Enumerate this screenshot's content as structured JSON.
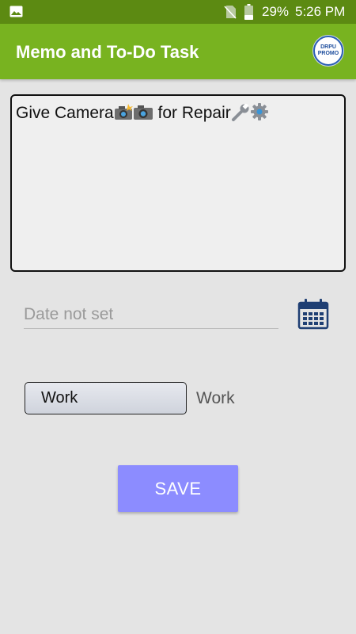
{
  "status_bar": {
    "icons": [
      "gallery-icon",
      "no-sim-icon",
      "battery-icon"
    ],
    "battery": "29%",
    "time": "5:26 PM"
  },
  "app_bar": {
    "title": "Memo and To-Do Task",
    "promo_line1": "DRPU",
    "promo_line2": "PROMO",
    "colors": {
      "app_bar": "#78b320",
      "status_bar": "#5c8a12"
    }
  },
  "memo": {
    "text_part1": "Give Camera",
    "text_part2": " for Repair",
    "emoji_icons": [
      "camera-flash-icon",
      "camera-icon",
      "wrench-icon",
      "gear-icon"
    ]
  },
  "date": {
    "placeholder": "Date not set",
    "icon": "calendar-icon"
  },
  "category": {
    "selected": "Work",
    "label": "Work"
  },
  "save": {
    "label": "SAVE",
    "color": "#8c8cff"
  }
}
